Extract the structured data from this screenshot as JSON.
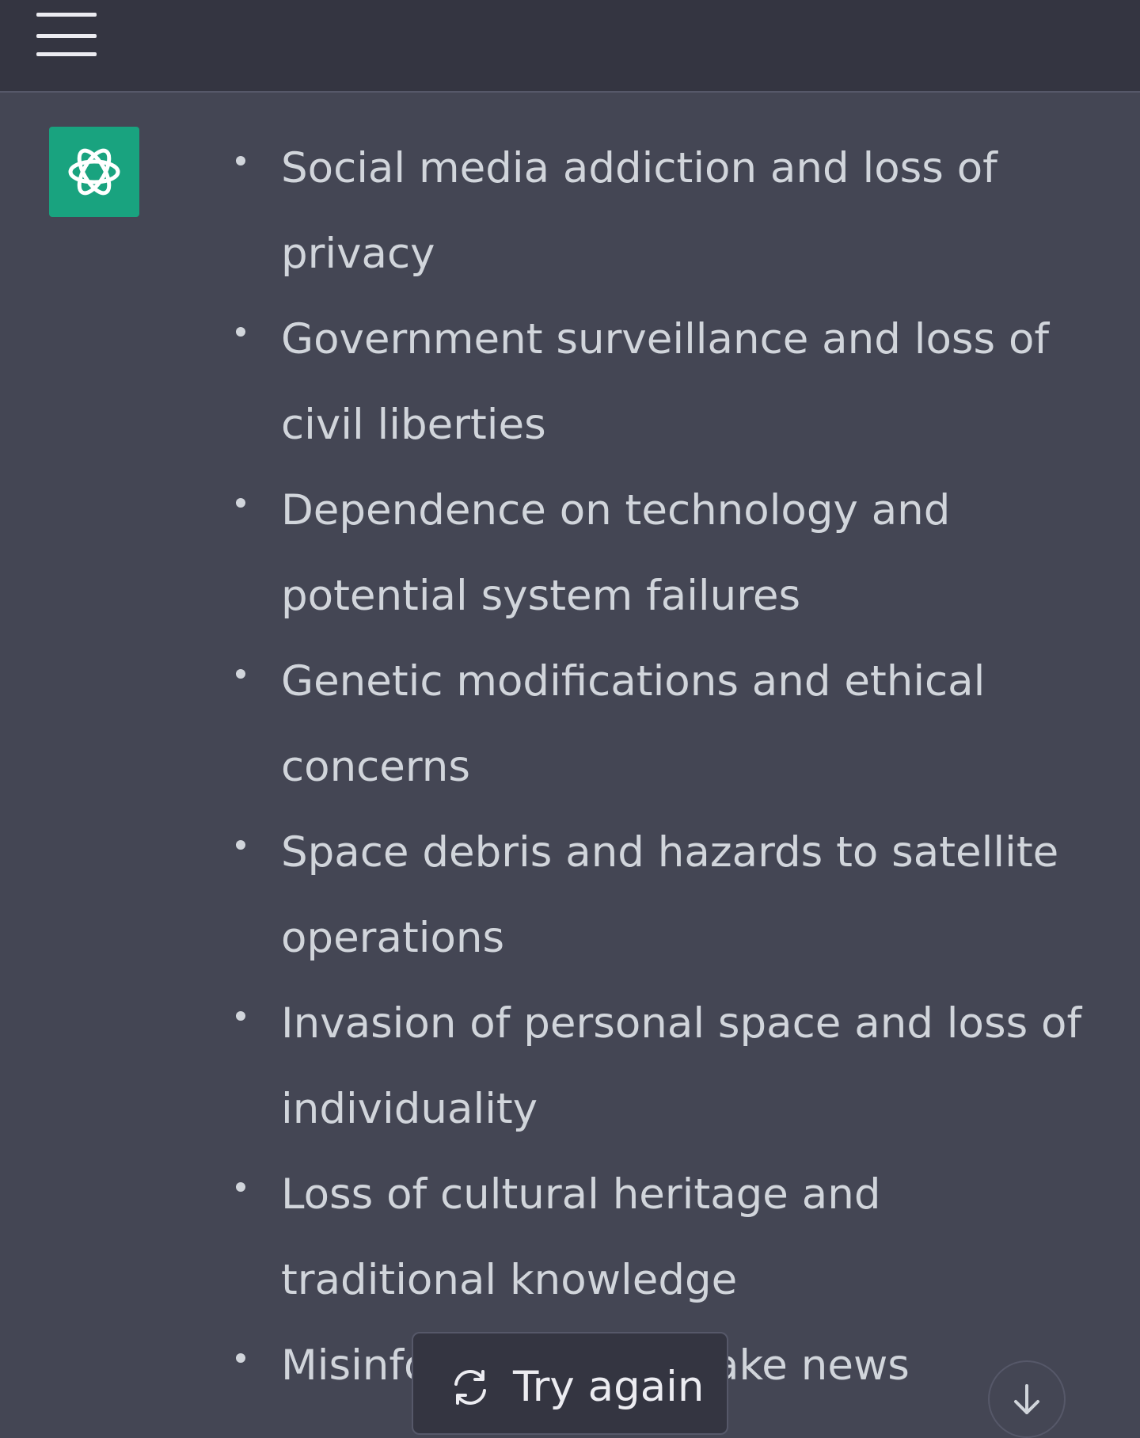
{
  "header": {
    "menu_icon": "hamburger-menu-icon"
  },
  "assistant": {
    "avatar_icon": "openai-logo-icon",
    "avatar_color": "#19a37f",
    "bullets": [
      "Social media addiction and loss of privacy",
      "Government surveillance and loss of civil liberties",
      "Dependence on technology and potential system failures",
      "Genetic modifications and ethical concerns",
      "Space debris and hazards to satellite operations",
      "Invasion of personal space and loss of individuality",
      "Loss of cultural heritage and traditional knowledge",
      "Misinformation and fake news"
    ]
  },
  "controls": {
    "try_again_label": "Try again",
    "try_again_icon": "refresh-icon",
    "scroll_down_icon": "arrow-down-icon"
  },
  "colors": {
    "topbar_bg": "#343541",
    "content_bg": "#444654",
    "text": "#d1d5db",
    "accent": "#19a37f"
  }
}
